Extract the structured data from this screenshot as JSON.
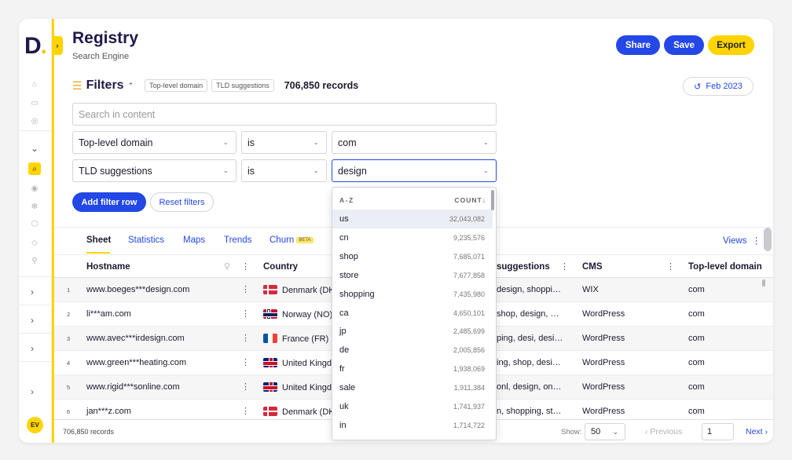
{
  "app": {
    "logo": "D.",
    "title": "Registry",
    "subtitle": "Search Engine",
    "share_label": "Share",
    "save_label": "Save",
    "export_label": "Export",
    "avatar_initials": "EV"
  },
  "colors": {
    "accent": "#2348e6",
    "brand_yellow": "#ffd400",
    "navy": "#21184a"
  },
  "filters": {
    "title": "Filters",
    "chips": [
      "Top-level domain",
      "TLD suggestions"
    ],
    "records": "706,850 records",
    "date_label": "Feb 2023",
    "search_placeholder": "Search in content",
    "rows": [
      {
        "field": "Top-level domain",
        "operator": "is",
        "value": "com"
      },
      {
        "field": "TLD suggestions",
        "operator": "is",
        "value": "design"
      }
    ],
    "add_label": "Add filter row",
    "reset_label": "Reset filters"
  },
  "tabs": {
    "items": [
      "Sheet",
      "Statistics",
      "Maps",
      "Trends",
      "Churn"
    ],
    "beta_label": "BETA",
    "views_label": "Views"
  },
  "table": {
    "columns": [
      "Hostname",
      "Country",
      "suggestions",
      "CMS",
      "Top-level domain"
    ],
    "rows": [
      {
        "num": "1",
        "hostname": "www.boeges***design.com",
        "country": "Denmark (DK",
        "flag": "dk",
        "suggestions": "design, shoppi…",
        "cms": "WIX",
        "tld": "com"
      },
      {
        "num": "2",
        "hostname": "li***am.com",
        "country": "Norway (NO)",
        "flag": "no",
        "suggestions": "shop, design, …",
        "cms": "WordPress",
        "tld": "com"
      },
      {
        "num": "3",
        "hostname": "www.avec***irdesign.com",
        "country": "France (FR)",
        "flag": "fr",
        "suggestions": "ping, desi, desi…",
        "cms": "WordPress",
        "tld": "com"
      },
      {
        "num": "4",
        "hostname": "www.green***heating.com",
        "country": "United Kingd",
        "flag": "uk",
        "suggestions": "ing, shop, desi…",
        "cms": "WordPress",
        "tld": "com"
      },
      {
        "num": "5",
        "hostname": "www.rigid***sonline.com",
        "country": "United Kingd",
        "flag": "uk",
        "suggestions": "onl, design, on…",
        "cms": "WordPress",
        "tld": "com"
      },
      {
        "num": "6",
        "hostname": "jan***z.com",
        "country": "Denmark (DK",
        "flag": "dk",
        "suggestions": "n, shopping, st…",
        "cms": "WordPress",
        "tld": "com"
      }
    ]
  },
  "footer": {
    "records": "706,850 records",
    "show_label": "Show:",
    "page_size": "50",
    "previous_label": "‹ Previous",
    "page": "1",
    "next_label": "Next ›"
  },
  "dropdown": {
    "header_left": "A-Z",
    "header_right": "COUNT↓",
    "items": [
      {
        "label": "us",
        "count": "32,043,082"
      },
      {
        "label": "cn",
        "count": "9,235,576"
      },
      {
        "label": "shop",
        "count": "7,685,071"
      },
      {
        "label": "store",
        "count": "7,677,858"
      },
      {
        "label": "shopping",
        "count": "7,435,980"
      },
      {
        "label": "ca",
        "count": "4,650,101"
      },
      {
        "label": "jp",
        "count": "2,485,699"
      },
      {
        "label": "de",
        "count": "2,005,856"
      },
      {
        "label": "fr",
        "count": "1,938,069"
      },
      {
        "label": "sale",
        "count": "1,911,384"
      },
      {
        "label": "uk",
        "count": "1,741,937"
      },
      {
        "label": "in",
        "count": "1,714,722"
      }
    ]
  }
}
